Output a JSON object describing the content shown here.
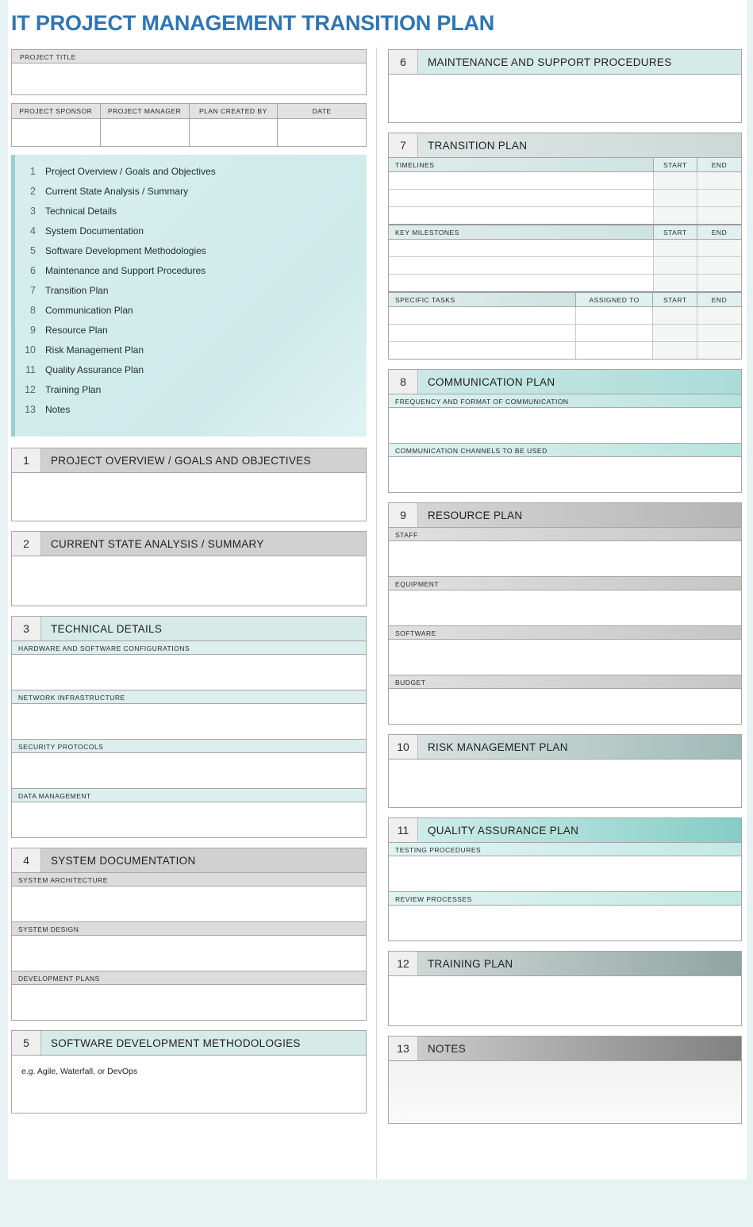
{
  "document": {
    "title": "IT PROJECT MANAGEMENT TRANSITION PLAN",
    "title_color": "#2e75b6"
  },
  "header": {
    "project_title_label": "PROJECT TITLE",
    "project_title_value": "",
    "meta_columns": [
      "PROJECT SPONSOR",
      "PROJECT MANAGER",
      "PLAN CREATED BY",
      "DATE"
    ],
    "meta_values": [
      "",
      "",
      "",
      ""
    ]
  },
  "toc": {
    "items": [
      {
        "num": "1",
        "label": "Project Overview / Goals and Objectives"
      },
      {
        "num": "2",
        "label": "Current State Analysis / Summary"
      },
      {
        "num": "3",
        "label": "Technical Details"
      },
      {
        "num": "4",
        "label": "System Documentation"
      },
      {
        "num": "5",
        "label": "Software Development Methodologies"
      },
      {
        "num": "6",
        "label": "Maintenance and Support Procedures"
      },
      {
        "num": "7",
        "label": "Transition Plan"
      },
      {
        "num": "8",
        "label": "Communication Plan"
      },
      {
        "num": "9",
        "label": "Resource Plan"
      },
      {
        "num": "10",
        "label": "Risk Management Plan"
      },
      {
        "num": "11",
        "label": "Quality Assurance Plan"
      },
      {
        "num": "12",
        "label": "Training Plan"
      },
      {
        "num": "13",
        "label": "Notes"
      }
    ]
  },
  "sections": {
    "s1": {
      "num": "1",
      "title": "PROJECT OVERVIEW  / GOALS AND OBJECTIVES",
      "value": ""
    },
    "s2": {
      "num": "2",
      "title": "CURRENT STATE ANALYSIS / SUMMARY",
      "value": ""
    },
    "s3": {
      "num": "3",
      "title": "TECHNICAL DETAILS",
      "subs": [
        {
          "label": "HARDWARE AND SOFTWARE CONFIGURATIONS",
          "value": ""
        },
        {
          "label": "NETWORK INFRASTRUCTURE",
          "value": ""
        },
        {
          "label": "SECURITY PROTOCOLS",
          "value": ""
        },
        {
          "label": "DATA MANAGEMENT",
          "value": ""
        }
      ]
    },
    "s4": {
      "num": "4",
      "title": "SYSTEM DOCUMENTATION",
      "subs": [
        {
          "label": "SYSTEM ARCHITECTURE",
          "value": ""
        },
        {
          "label": "SYSTEM DESIGN",
          "value": ""
        },
        {
          "label": "DEVELOPMENT PLANS",
          "value": ""
        }
      ]
    },
    "s5": {
      "num": "5",
      "title": "SOFTWARE DEVELOPMENT METHODOLOGIES",
      "hint": "e.g. Agile, Waterfall, or DevOps"
    },
    "s6": {
      "num": "6",
      "title": "MAINTENANCE AND SUPPORT PROCEDURES",
      "value": ""
    },
    "s7": {
      "num": "7",
      "title": "TRANSITION PLAN",
      "timelines": {
        "label": "TIMELINES",
        "columns": [
          "START",
          "END"
        ],
        "rows": [
          [
            "",
            "",
            ""
          ],
          [
            "",
            "",
            ""
          ],
          [
            "",
            "",
            ""
          ]
        ]
      },
      "milestones": {
        "label": "KEY MILESTONES",
        "columns": [
          "START",
          "END"
        ],
        "rows": [
          [
            "",
            "",
            ""
          ],
          [
            "",
            "",
            ""
          ],
          [
            "",
            "",
            ""
          ]
        ]
      },
      "tasks": {
        "label": "SPECIFIC TASKS",
        "columns": [
          "ASSIGNED TO",
          "START",
          "END"
        ],
        "rows": [
          [
            "",
            "",
            "",
            ""
          ],
          [
            "",
            "",
            "",
            ""
          ],
          [
            "",
            "",
            "",
            ""
          ]
        ]
      }
    },
    "s8": {
      "num": "8",
      "title": "COMMUNICATION PLAN",
      "subs": [
        {
          "label": "FREQUENCY AND FORMAT OF COMMUNICATION",
          "value": ""
        },
        {
          "label": "COMMUNICATION CHANNELS TO BE USED",
          "value": ""
        }
      ]
    },
    "s9": {
      "num": "9",
      "title": "RESOURCE PLAN",
      "subs": [
        {
          "label": "STAFF",
          "value": ""
        },
        {
          "label": "EQUIPMENT",
          "value": ""
        },
        {
          "label": "SOFTWARE",
          "value": ""
        },
        {
          "label": "BUDGET",
          "value": ""
        }
      ]
    },
    "s10": {
      "num": "10",
      "title": "RISK MANAGEMENT PLAN",
      "value": ""
    },
    "s11": {
      "num": "11",
      "title": "QUALITY ASSURANCE PLAN",
      "subs": [
        {
          "label": "TESTING PROCEDURES",
          "value": ""
        },
        {
          "label": "REVIEW PROCESSES",
          "value": ""
        }
      ]
    },
    "s12": {
      "num": "12",
      "title": "TRAINING PLAN",
      "value": ""
    },
    "s13": {
      "num": "13",
      "title": "NOTES",
      "value": ""
    }
  }
}
